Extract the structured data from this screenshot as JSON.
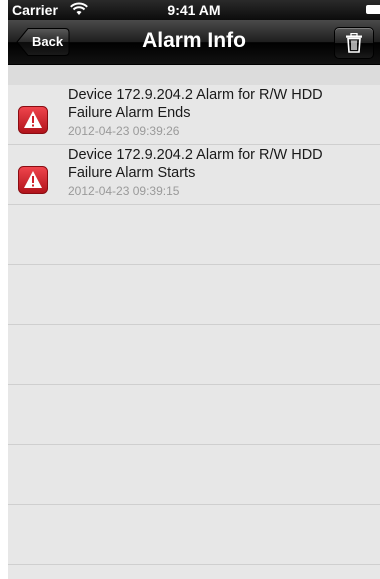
{
  "status_bar": {
    "carrier": "Carrier",
    "time": "9:41 AM"
  },
  "nav": {
    "back_label": "Back",
    "title": "Alarm Info"
  },
  "alarms": [
    {
      "line1": "Device 172.9.204.2 Alarm for R/W HDD",
      "line2": "Failure Alarm Ends",
      "timestamp": "2012-04-23 09:39:26"
    },
    {
      "line1": "Device 172.9.204.2 Alarm for R/W HDD",
      "line2": "Failure Alarm Starts",
      "timestamp": "2012-04-23 09:39:15"
    }
  ],
  "colors": {
    "alarm_red": "#d0202a",
    "navbar": "#1e1e1e",
    "row_bg": "#e7e7e7"
  }
}
